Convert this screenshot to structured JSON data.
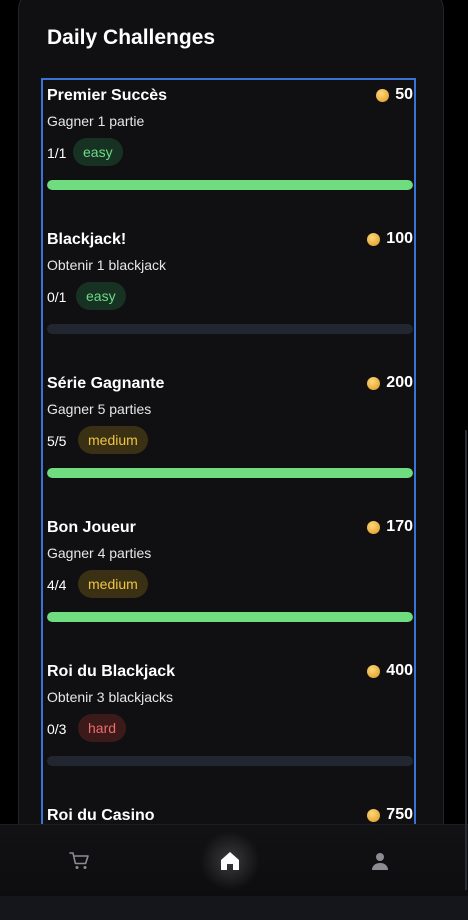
{
  "section": {
    "title": "Daily Challenges"
  },
  "challenges": [
    {
      "name": "Premier Succès",
      "reward": "50",
      "description": "Gagner 1 partie",
      "progress": "1/1",
      "difficulty": "easy",
      "completion": 1.0
    },
    {
      "name": "Blackjack!",
      "reward": "100",
      "description": "Obtenir 1 blackjack",
      "progress": "0/1",
      "difficulty": "easy",
      "completion": 0.0
    },
    {
      "name": "Série Gagnante",
      "reward": "200",
      "description": "Gagner 5 parties",
      "progress": "5/5",
      "difficulty": "medium",
      "completion": 1.0
    },
    {
      "name": "Bon Joueur",
      "reward": "170",
      "description": "Gagner 4 parties",
      "progress": "4/4",
      "difficulty": "medium",
      "completion": 1.0
    },
    {
      "name": "Roi du Blackjack",
      "reward": "400",
      "description": "Obtenir 3 blackjacks",
      "progress": "0/3",
      "difficulty": "hard",
      "completion": 0.0
    },
    {
      "name": "Roi du Casino",
      "reward": "750",
      "description": "",
      "progress": "",
      "difficulty": "",
      "completion": 0.0
    }
  ],
  "colors": {
    "accent_focus": "#3a73d6",
    "progress_fill": "#6fdc80",
    "coin": "#e8a93a",
    "easy": "#6ddc85",
    "medium": "#f0c440",
    "hard": "#ef6b6b"
  },
  "bottom_nav": {
    "items": [
      {
        "icon": "cart-icon",
        "active": false
      },
      {
        "icon": "home-icon",
        "active": true
      },
      {
        "icon": "profile-icon",
        "active": false
      }
    ]
  }
}
